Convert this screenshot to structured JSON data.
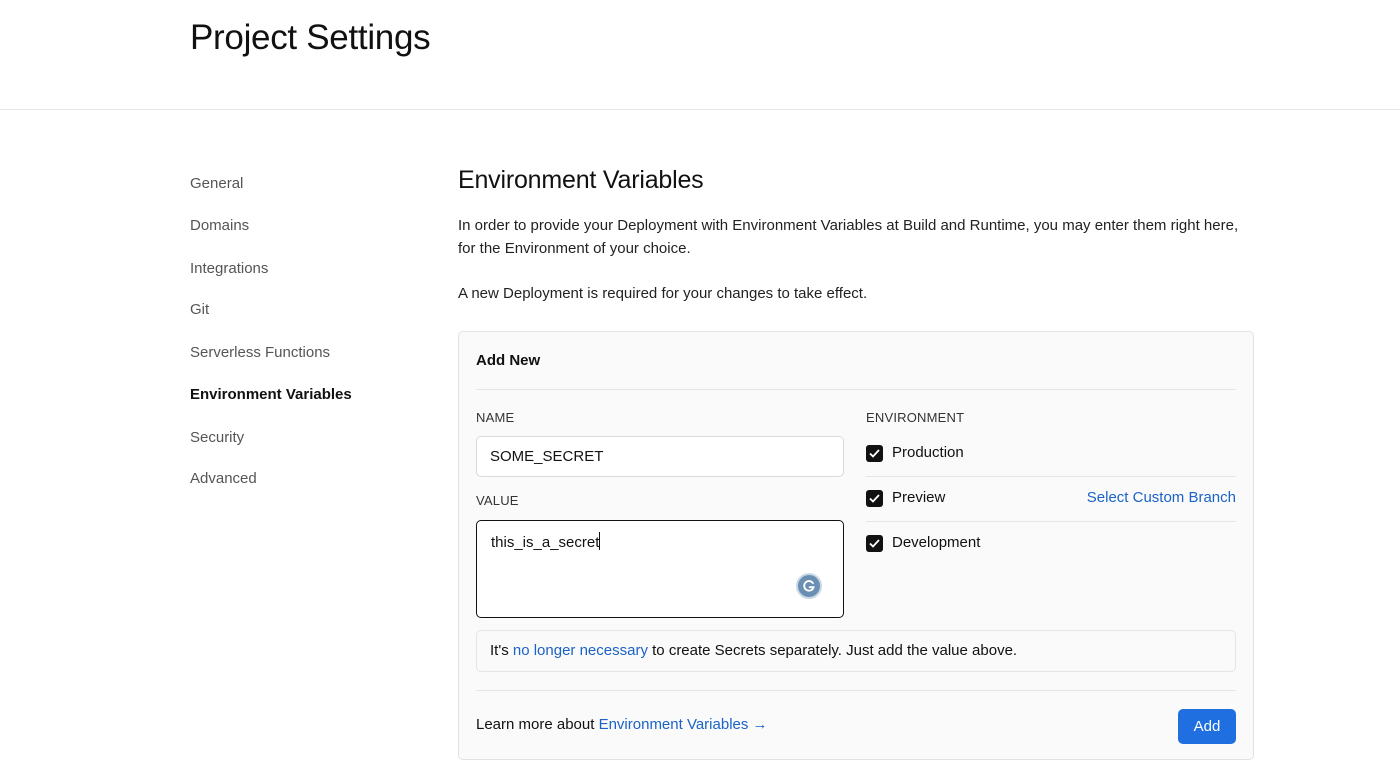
{
  "header": {
    "title": "Project Settings"
  },
  "sidebar": {
    "items": [
      {
        "label": "General"
      },
      {
        "label": "Domains"
      },
      {
        "label": "Integrations"
      },
      {
        "label": "Git"
      },
      {
        "label": "Serverless Functions"
      },
      {
        "label": "Environment Variables",
        "active": true
      },
      {
        "label": "Security"
      },
      {
        "label": "Advanced"
      }
    ]
  },
  "main": {
    "title": "Environment Variables",
    "description": "In order to provide your Deployment with Environment Variables at Build and Runtime, you may enter them right here, for the Environment of your choice.",
    "note": "A new Deployment is required for your changes to take effect."
  },
  "card": {
    "title": "Add New",
    "name_label": "NAME",
    "name_value": "SOME_SECRET",
    "value_label": "VALUE",
    "value_value": "this_is_a_secret",
    "environment_label": "ENVIRONMENT",
    "environments": [
      {
        "label": "Production",
        "checked": true
      },
      {
        "label": "Preview",
        "checked": true
      },
      {
        "label": "Development",
        "checked": true
      }
    ],
    "custom_branch_link": "Select Custom Branch",
    "secrets_note": {
      "prefix": "It's ",
      "link": "no longer necessary",
      "suffix": " to create Secrets separately. Just add the value above."
    },
    "footer": {
      "prefix": "Learn more about ",
      "link": "Environment Variables →"
    },
    "add_button": "Add"
  },
  "colors": {
    "link": "#1a63c7",
    "primary_button": "#1f6fe0",
    "checkbox": "#111111"
  },
  "icons": {
    "checkbox": "checkmark-icon",
    "grammarly": "grammarly-icon"
  }
}
